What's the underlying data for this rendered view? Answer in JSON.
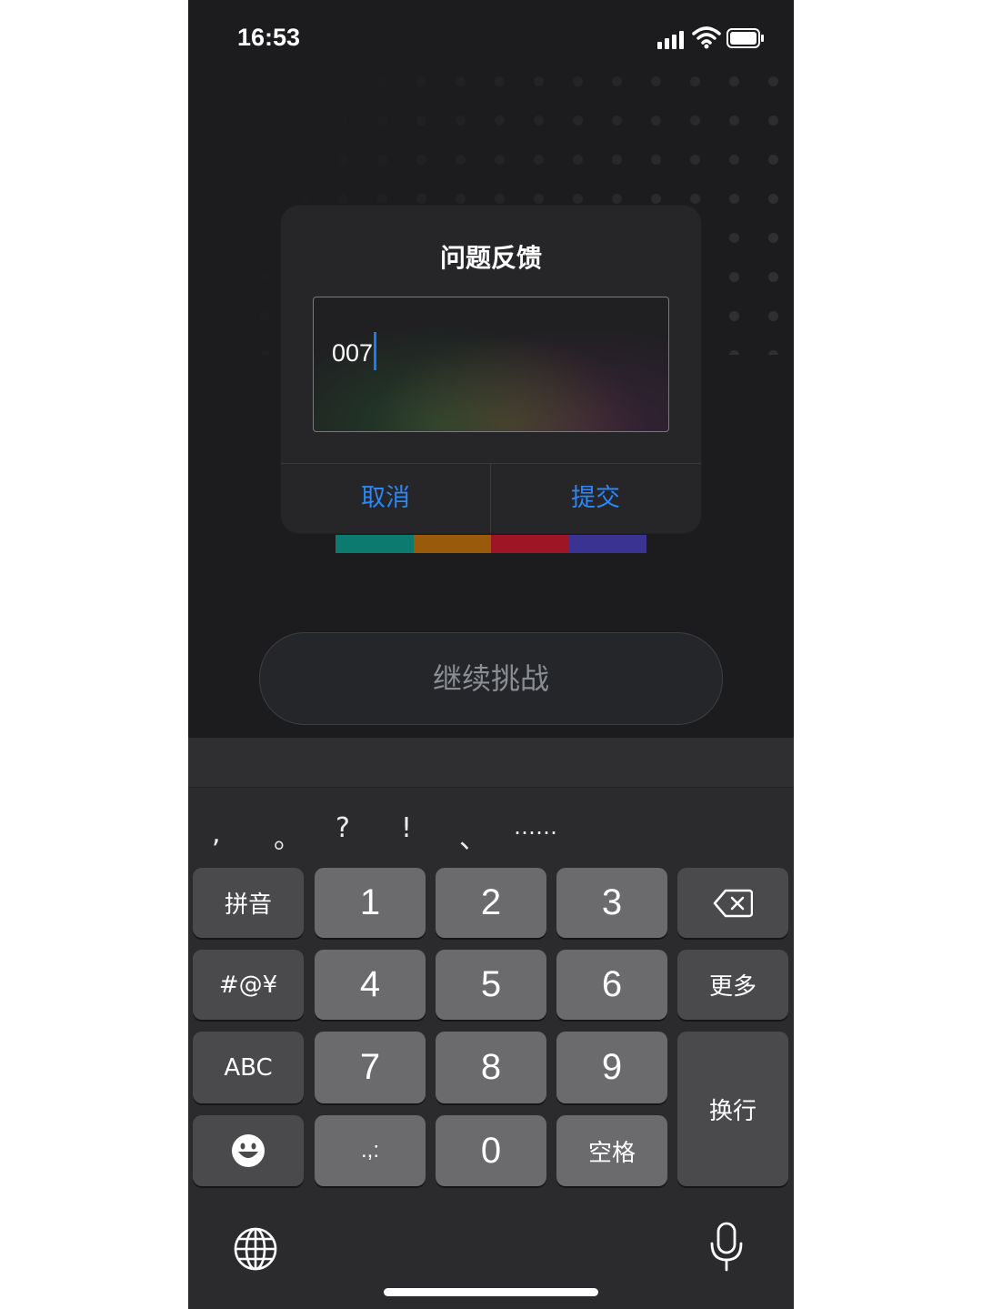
{
  "status_bar": {
    "time": "16:53",
    "icons": [
      "cellular-signal-icon",
      "wifi-icon",
      "battery-icon"
    ]
  },
  "dialog": {
    "title": "问题反馈",
    "input_value": "007",
    "cancel_label": "取消",
    "submit_label": "提交"
  },
  "color_bar": [
    "#0d7a70",
    "#9a5a0c",
    "#9e1526",
    "#3b3392"
  ],
  "continue_label": "继续挑战",
  "keyboard": {
    "punctuation": [
      ",",
      "。",
      "?",
      "!",
      "、",
      "……"
    ],
    "keys": {
      "pinyin": "拼音",
      "k1": "1",
      "k2": "2",
      "k3": "3",
      "symbols": "#@¥",
      "k4": "4",
      "k5": "5",
      "k6": "6",
      "more": "更多",
      "abc": "ABC",
      "k7": "7",
      "k8": "8",
      "k9": "9",
      "enter": "换行",
      "punct": ".,:",
      "k0": "0",
      "space": "空格"
    },
    "icons": [
      "delete-icon",
      "emoji-icon",
      "globe-icon",
      "microphone-icon"
    ],
    "accent": "#2c86f5"
  }
}
